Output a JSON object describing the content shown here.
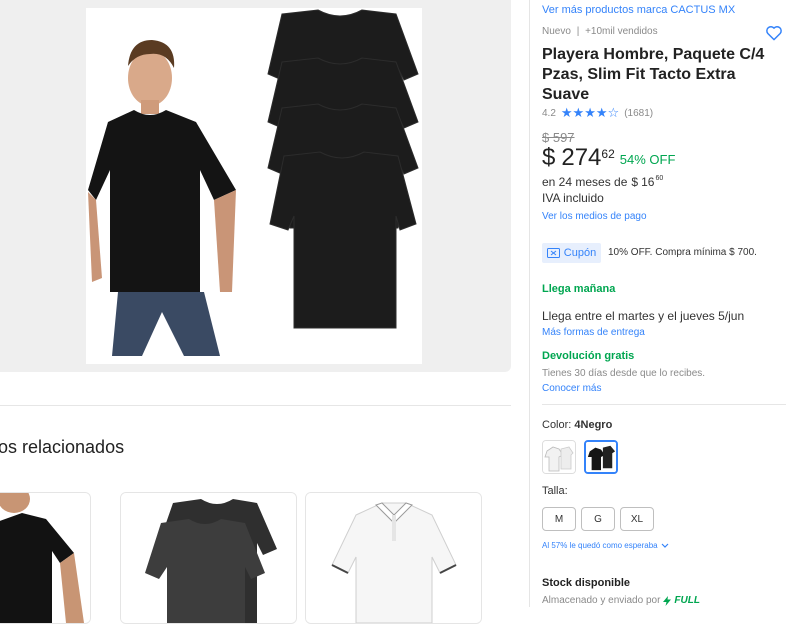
{
  "related": {
    "title": "os relacionados"
  },
  "product": {
    "brand_link": "Ver más productos marca CACTUS MX",
    "condition": "Nuevo",
    "separator": "|",
    "sold": "+10mil vendidos",
    "title": "Playera Hombre, Paquete C/4 Pzas, Slim Fit Tacto Extra Suave",
    "rating": "4.2",
    "stars": "★★★★☆",
    "reviews": "(1681)",
    "old_price": "$ 597",
    "currency": "$",
    "price_int": "274",
    "price_cents": "62",
    "discount": "54% OFF",
    "installments_prefix": "en 24 meses de",
    "installment_currency": "$",
    "installment_int": "16",
    "installment_cents": "60",
    "iva": "IVA incluido",
    "payment_link": "Ver los medios de pago",
    "coupon_label": "Cupón",
    "coupon_text": "10% OFF. Compra mínima $ 700.",
    "delivery_title": "Llega mañana",
    "delivery_text": "Llega entre el martes y el jueves 5/jun",
    "delivery_link": "Más formas de entrega",
    "return_title": "Devolución gratis",
    "return_text": "Tienes 30 días desde que lo recibes.",
    "return_link": "Conocer más",
    "color_label": "Color:",
    "color_value": "4Negro",
    "size_label": "Talla:",
    "sizes": [
      "M",
      "G",
      "XL"
    ],
    "fit_note": "Al 57% le quedó como esperaba",
    "stock_title": "Stock disponible",
    "stock_text": "Almacenado y enviado por",
    "full_label": "FULL"
  },
  "colors": {
    "accent": "#3483fa",
    "green": "#00a650"
  }
}
